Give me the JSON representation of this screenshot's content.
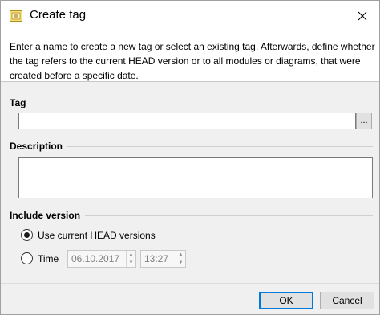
{
  "window": {
    "title": "Create tag",
    "icon": "tag-window-icon"
  },
  "banner": {
    "text": "Enter a name to create a new tag or select an existing tag. Afterwards, define whether the tag refers to the current HEAD version or to all modules or diagrams, that were created before a specific date."
  },
  "tag_group": {
    "label": "Tag",
    "value": "",
    "browse_label": "..."
  },
  "description_group": {
    "label": "Description",
    "value": ""
  },
  "version_group": {
    "label": "Include version",
    "options": [
      {
        "label": "Use current HEAD versions",
        "checked": true
      },
      {
        "label": "Time",
        "checked": false
      }
    ],
    "date_value": "06.10.2017",
    "time_value": "13:27"
  },
  "buttons": {
    "ok_label": "OK",
    "cancel_label": "Cancel"
  },
  "colors": {
    "accent": "#0078d7",
    "window_bg": "#f0f0f0",
    "banner_bg": "#ffffff"
  }
}
